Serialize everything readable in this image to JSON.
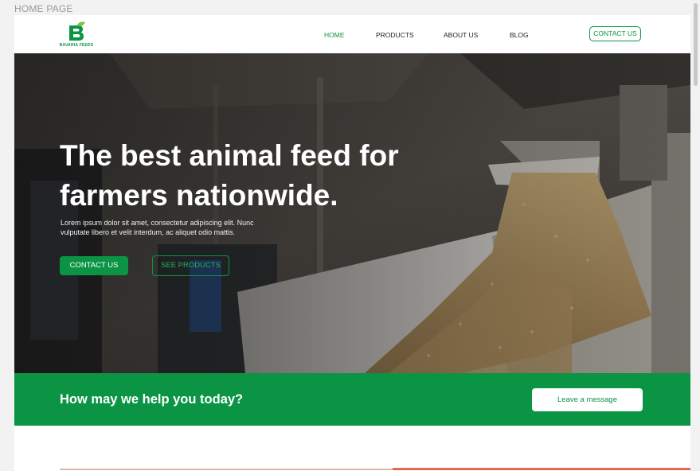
{
  "page_label": "HOME PAGE",
  "brand": {
    "name": "BAVARIA FEEDS",
    "logo_letter": "B"
  },
  "nav": {
    "home": "HOME",
    "products": "PRODUCTS",
    "about": "ABOUT US",
    "blog": "BLOG",
    "contact": "CONTACT US"
  },
  "hero": {
    "title_line1": "The best animal feed for",
    "title_line2": "farmers nationwide.",
    "subtitle_line1": "Lorem ipsum dolor sit amet, consectetur adipiscing elit. Nunc",
    "subtitle_line2": "vulputate libero et velit interdum, ac aliquet odio mattis.",
    "primary_button": "CONTACT US",
    "secondary_button": "SEE PRODUCTS"
  },
  "help": {
    "title": "How may we help you today?",
    "button": "Leave a message"
  },
  "colors": {
    "brand_green": "#0b9444",
    "white": "#ffffff"
  }
}
